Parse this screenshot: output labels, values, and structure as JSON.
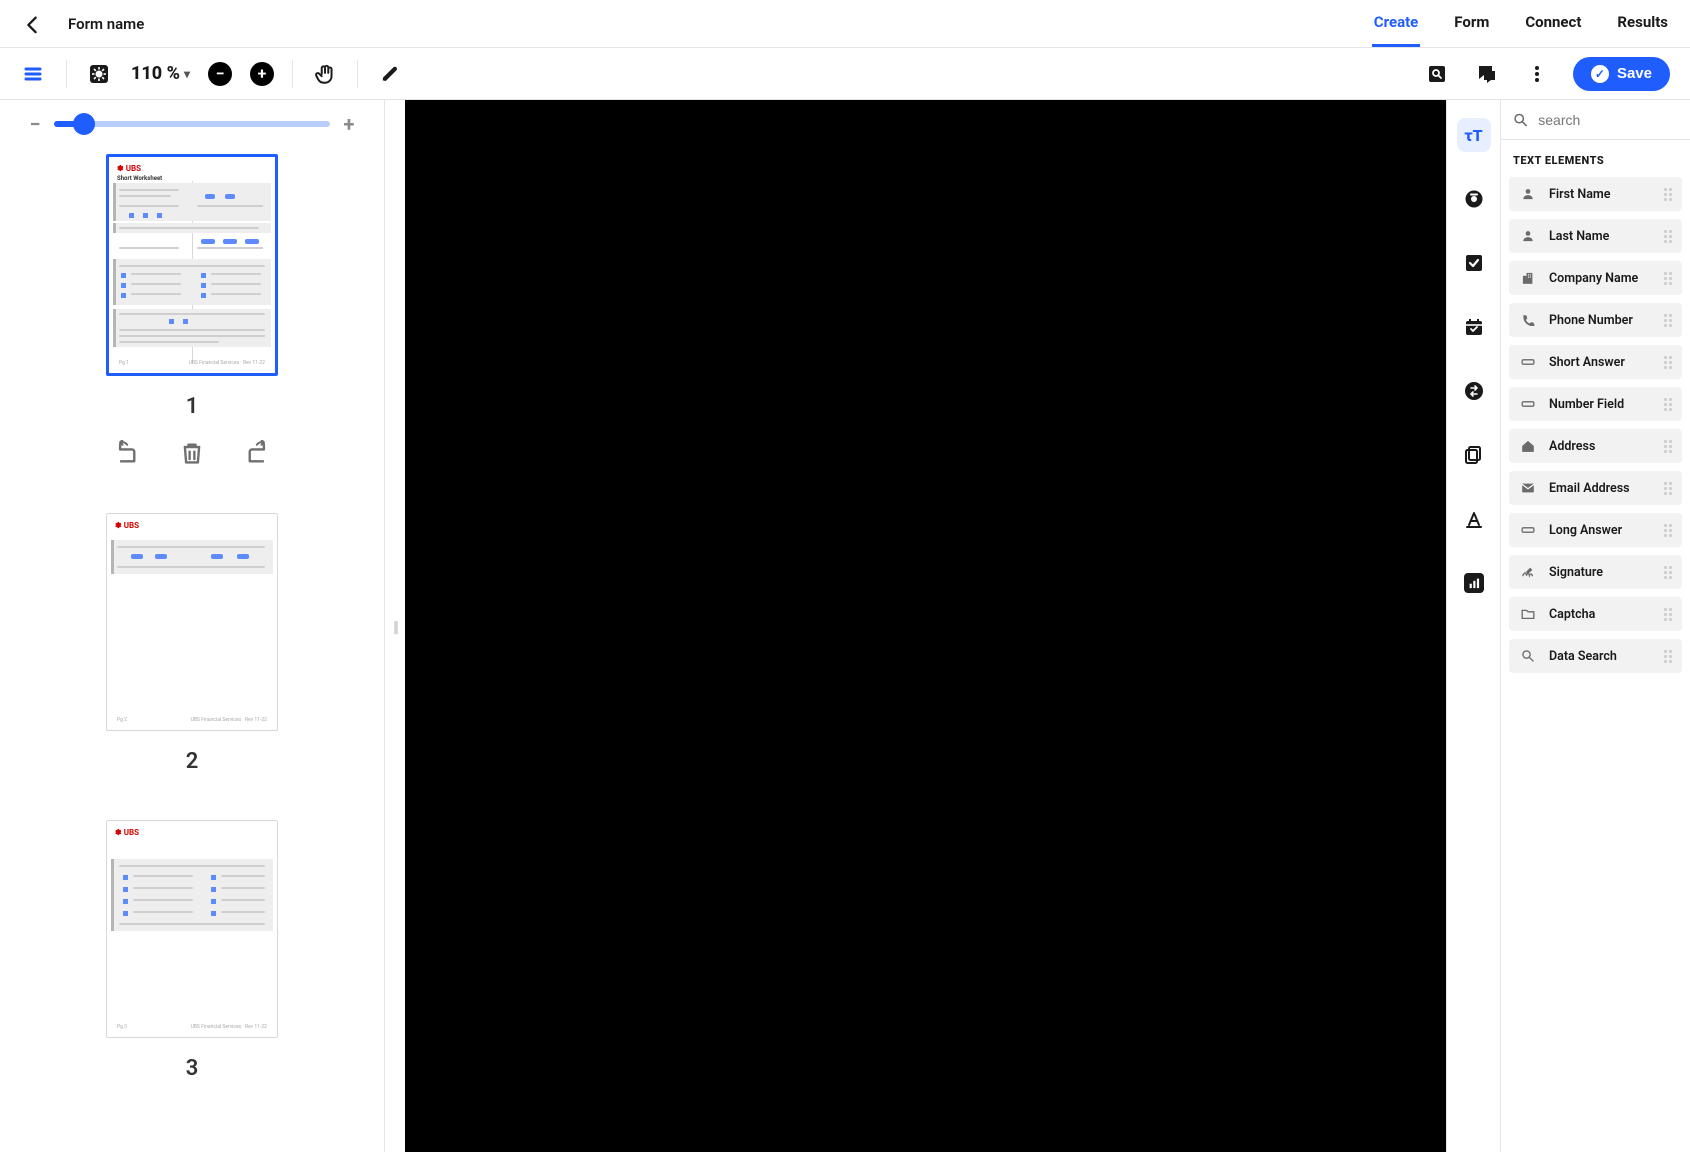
{
  "header": {
    "title": "Form name",
    "tabs": [
      {
        "label": "Create",
        "active": true
      },
      {
        "label": "Form",
        "active": false
      },
      {
        "label": "Connect",
        "active": false
      },
      {
        "label": "Results",
        "active": false
      }
    ]
  },
  "toolbar": {
    "zoom_label": "110 %",
    "save_label": "Save"
  },
  "thumbs": {
    "pages": [
      {
        "number": "1",
        "selected": true
      },
      {
        "number": "2",
        "selected": false
      },
      {
        "number": "3",
        "selected": false
      }
    ]
  },
  "right": {
    "search_placeholder": "search",
    "section_header": "TEXT ELEMENTS",
    "categories": [
      {
        "name": "text",
        "active": true
      },
      {
        "name": "photo",
        "active": false
      },
      {
        "name": "checkbox",
        "active": false
      },
      {
        "name": "date",
        "active": false
      },
      {
        "name": "swap",
        "active": false
      },
      {
        "name": "copy",
        "active": false
      },
      {
        "name": "text-format",
        "active": false
      },
      {
        "name": "chart",
        "active": false
      }
    ],
    "elements": [
      {
        "label": "First Name",
        "icon": "person"
      },
      {
        "label": "Last Name",
        "icon": "person"
      },
      {
        "label": "Company Name",
        "icon": "business"
      },
      {
        "label": "Phone Number",
        "icon": "phone"
      },
      {
        "label": "Short Answer",
        "icon": "short"
      },
      {
        "label": "Number Field",
        "icon": "short"
      },
      {
        "label": "Address",
        "icon": "home"
      },
      {
        "label": "Email Address",
        "icon": "mail"
      },
      {
        "label": "Long Answer",
        "icon": "short"
      },
      {
        "label": "Signature",
        "icon": "signature"
      },
      {
        "label": "Captcha",
        "icon": "folder"
      },
      {
        "label": "Data Search",
        "icon": "search"
      }
    ]
  }
}
